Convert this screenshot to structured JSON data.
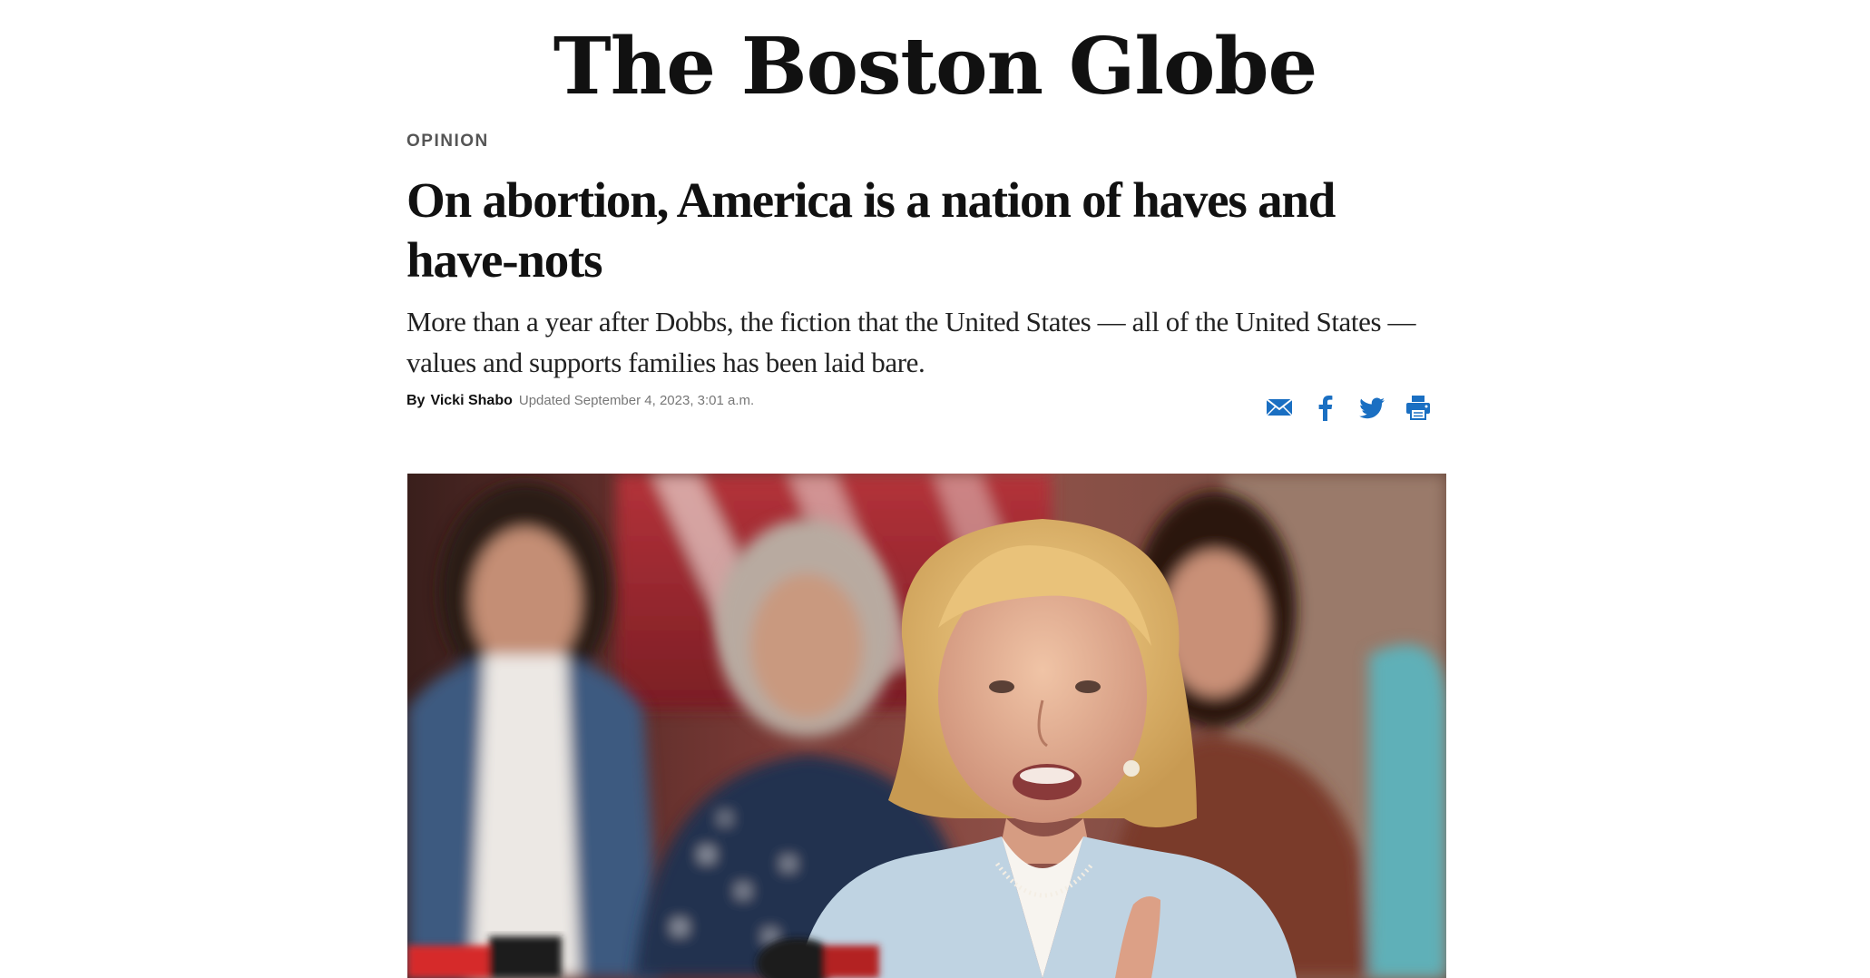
{
  "masthead": {
    "title": "The Boston Globe"
  },
  "article": {
    "section": "OPINION",
    "headline": "On abortion, America is a nation of haves and have-nots",
    "dek": "More than a year after Dobbs, the fiction that the United States — all of the United States — values and supports families has been laid bare.",
    "byline": {
      "by_label": "By",
      "author": "Vicki Shabo",
      "updated": "Updated September 4, 2023, 3:01 a.m."
    }
  },
  "share": {
    "icons": [
      "email-icon",
      "facebook-icon",
      "twitter-icon",
      "print-icon"
    ],
    "color": "#1a6fc2"
  },
  "photo": {
    "icon": "photo"
  }
}
